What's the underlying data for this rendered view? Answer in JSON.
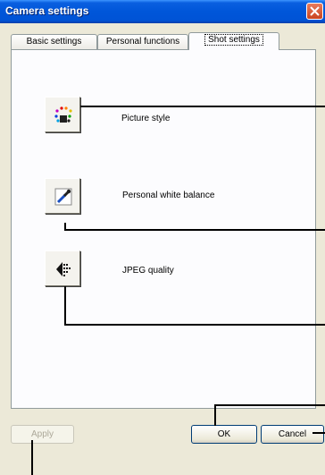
{
  "window": {
    "title": "Camera settings"
  },
  "tabs": [
    {
      "label": "Basic settings",
      "active": false
    },
    {
      "label": "Personal functions",
      "active": false
    },
    {
      "label": "Shot settings",
      "active": true
    }
  ],
  "settings": [
    {
      "label": "Picture style",
      "icon": "picture-style-icon"
    },
    {
      "label": "Personal white balance",
      "icon": "eyedropper-icon"
    },
    {
      "label": "JPEG quality",
      "icon": "jpeg-quality-icon"
    }
  ],
  "buttons": {
    "apply": "Apply",
    "ok": "OK",
    "cancel": "Cancel"
  },
  "colors": {
    "titlebar": "#0054e3",
    "close": "#d9532c",
    "panel": "#fcfcfe"
  }
}
